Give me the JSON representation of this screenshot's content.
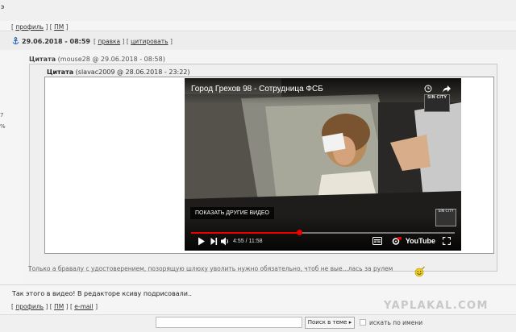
{
  "top_char": "э",
  "post_links_top": {
    "open": "[",
    "profile": "профиль",
    "mid": "] [",
    "pm": "ПМ",
    "close": "]"
  },
  "side_numbers": [
    "7",
    "%"
  ],
  "post": {
    "date": "29.06.2018 - 08:59",
    "edit_label": "правка",
    "quote_label": "цитировать",
    "brackets": {
      "a": "[",
      "b": "] [",
      "c": "]"
    }
  },
  "quote1": {
    "label": "Цитата",
    "meta": "(mouse28 @ 29.06.2018 - 08:58)"
  },
  "quote2": {
    "label": "Цитата",
    "meta": "(slavac2009 @ 28.06.2018 - 23:22)"
  },
  "video": {
    "title": "Город Грехов 98 - Сотрудница ФСБ",
    "channel_badge": "SIN CITY",
    "more_videos": "ПОКАЗАТЬ ДРУГИЕ ВИДЕО",
    "corner_badge": "SIN CITY",
    "current_time": "4:55",
    "time_sep": "/",
    "duration": "11:58",
    "progress": 0.41,
    "brand": "YouTube"
  },
  "quote_reply_text": "Только а бравалу с удостоверением, позорящую шлюху уволить нужно обязательно, чтоб не вые...лась за рулем",
  "main_text": "Так этого в видео! В редакторе ксиву подрисовали..",
  "post_links_bottom": {
    "open": "[",
    "profile": "профиль",
    "mid1": "] [",
    "pm": "ПМ",
    "mid2": "] [",
    "email": "e-mail",
    "close": "]"
  },
  "site_logo": "YAPLAKAL.COM",
  "search": {
    "input_value": "",
    "button_label": "Поиск в теме ▸",
    "checkbox_label": "искать по имени"
  },
  "colors": {
    "accent_red": "#e00000",
    "logo_gray": "#c8c8c8"
  }
}
